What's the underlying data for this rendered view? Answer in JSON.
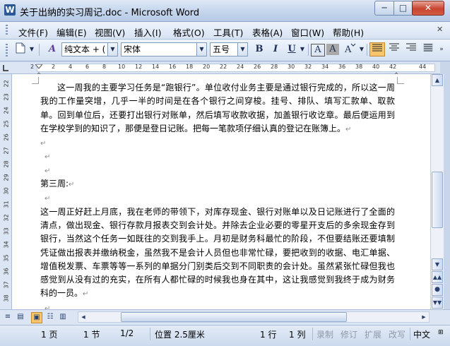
{
  "window": {
    "title": "关于出纳的实习周记.doc - Microsoft Word",
    "app_icon": "W",
    "minimize": "─",
    "maximize": "□",
    "close": "✕"
  },
  "menu": [
    "文件(F)",
    "编辑(E)",
    "视图(V)",
    "插入(I)",
    "格式(O)",
    "工具(T)",
    "表格(A)",
    "窗口(W)",
    "帮助(H)"
  ],
  "toolbar": {
    "style_value": "纯文本 + (",
    "font_value": "宋体",
    "size_value": "五号",
    "bold": "B",
    "italic": "I",
    "underline": "U",
    "char_border": "A",
    "char_shading": "A",
    "style_icon": "A"
  },
  "ruler": {
    "h_ticks": [
      "2",
      "2",
      "4",
      "6",
      "8",
      "10",
      "12",
      "14",
      "16",
      "18",
      "20",
      "22",
      "24",
      "26",
      "28",
      "30",
      "32",
      "34",
      "36",
      "38",
      "40",
      "42",
      "44"
    ],
    "v_ticks": [
      "22",
      "23",
      "24",
      "25",
      "26",
      "27",
      "28",
      "29",
      "30",
      "31",
      "32",
      "33",
      "34",
      "35",
      "36",
      "37",
      "38",
      "39"
    ]
  },
  "document": {
    "para1": "这一周我的主要学习任务是“跑银行”。单位收付业务主要是通过银行完成的，所以这一周我的工作量突增，几乎一半的时间是在各个银行之间穿梭。挂号、排队、填写汇款单、取款单。回到单位后，还要打出银行对账单，然后填写收款收据，加盖银行收讫章。最后便运用到在学校学到的知识了，那便是登日记账。把每一笔款项仔细认真的登记在账簿上。",
    "heading": "第三周:",
    "para2": "这一周正好赶上月底，我在老师的带领下，对库存现金、银行对账单以及日记账进行了全面的清点，做出现金、银行存款月报表交到会计处。并除去企业必要的零星开支后的多余现金存到银行，当然这个任务一如既往的交到我手上。月初是财务科最忙的阶段，不但要结账还要填制凭证做出报表并缴纳税金，虽然我不是会计人员但也非常忙碌，要把收到的收据、电汇单据、增值税发票、车票等等一系列的单据分门别类后交到不同职责的会计处。虽然紧张忙碌但我也感觉到从没有过的充实，在所有人都忙碌的时候我也身在其中，这让我感觉到我终于成为财务科的一员。",
    "para_mark": "↵"
  },
  "status": {
    "page": "1 页",
    "section": "1 节",
    "page_of": "1/2",
    "position": "位置 2.5厘米",
    "line": "1 行",
    "column": "1 列",
    "rec": "录制",
    "trk": "修订",
    "ext": "扩展",
    "ovr": "改写",
    "language": "中文"
  }
}
